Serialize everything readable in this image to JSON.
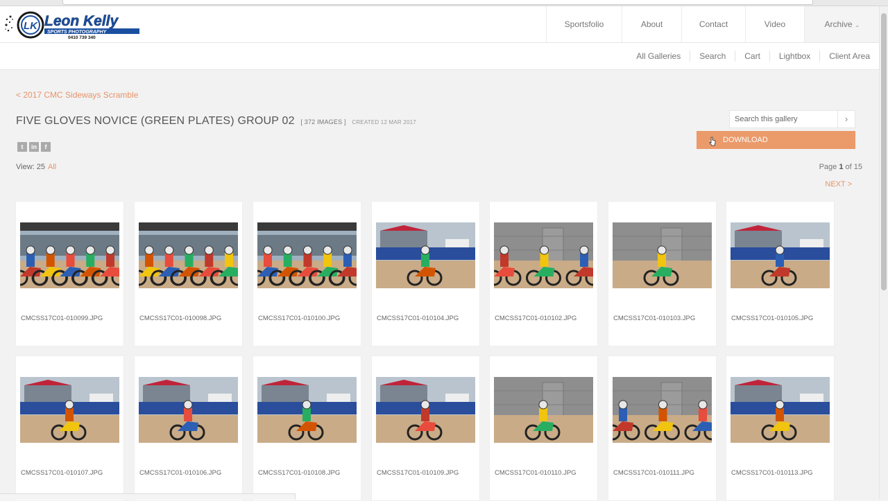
{
  "logo": {
    "name": "Leon Kelly",
    "tagline": "SPORTS PHOTOGRAPHY",
    "phone": "0410 739 340",
    "initials": "LK"
  },
  "main_nav": [
    "Sportsfolio",
    "About",
    "Contact",
    "Video",
    "Archive"
  ],
  "sub_nav": [
    "All Galleries",
    "Search",
    "Cart",
    "Lightbox",
    "Client Area"
  ],
  "breadcrumb": "< 2017 CMC Sideways Scramble",
  "gallery": {
    "title": "FIVE GLOVES NOVICE (GREEN PLATES) GROUP 02",
    "count": "[ 372 IMAGES ]",
    "created": "CREATED 12 MAR 2017"
  },
  "social": [
    "t",
    "in",
    "f"
  ],
  "view": {
    "label": "View: 25",
    "all": "All"
  },
  "search": {
    "placeholder": "Search this gallery",
    "button": "›"
  },
  "download": {
    "label": "DOWNLOAD",
    "icon": "arrow-down-icon"
  },
  "pagination": {
    "prefix": "Page",
    "current": "1",
    "suffix": "of 15",
    "next": "NEXT >"
  },
  "images": [
    {
      "file": "CMCSS17C01-010099.JPG",
      "scene": "group"
    },
    {
      "file": "CMCSS17C01-010098.JPG",
      "scene": "group"
    },
    {
      "file": "CMCSS17C01-010100.JPG",
      "scene": "group"
    },
    {
      "file": "CMCSS17C01-010104.JPG",
      "scene": "single"
    },
    {
      "file": "CMCSS17C01-010102.JPG",
      "scene": "wall"
    },
    {
      "file": "CMCSS17C01-010103.JPG",
      "scene": "wall"
    },
    {
      "file": "CMCSS17C01-010105.JPG",
      "scene": "single"
    },
    {
      "file": "CMCSS17C01-010107.JPG",
      "scene": "single"
    },
    {
      "file": "CMCSS17C01-010106.JPG",
      "scene": "single"
    },
    {
      "file": "CMCSS17C01-010108.JPG",
      "scene": "single"
    },
    {
      "file": "CMCSS17C01-010109.JPG",
      "scene": "single"
    },
    {
      "file": "CMCSS17C01-010110.JPG",
      "scene": "wall"
    },
    {
      "file": "CMCSS17C01-010111.JPG",
      "scene": "wall"
    },
    {
      "file": "CMCSS17C01-010113.JPG",
      "scene": "single"
    }
  ],
  "colors": {
    "accent": "#e6936a",
    "download_bg": "#eb9a6a",
    "logo_blue": "#1a4fa0"
  }
}
